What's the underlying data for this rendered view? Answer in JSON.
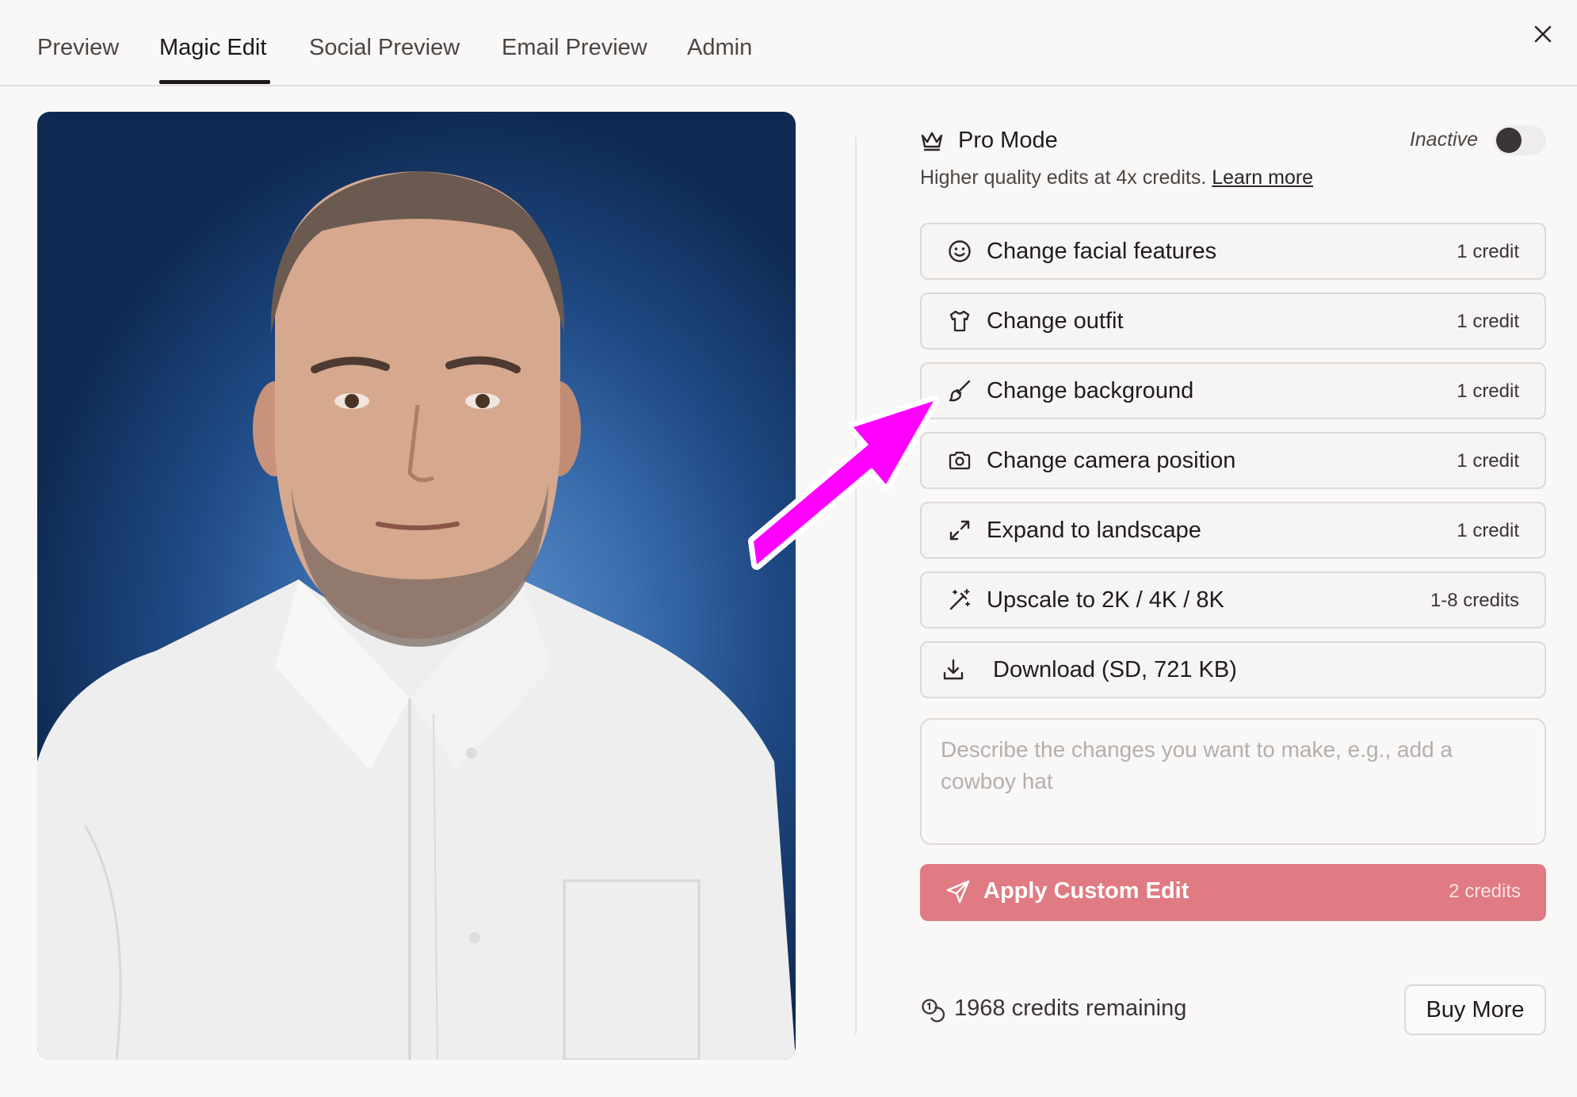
{
  "tabs": [
    {
      "label": "Preview"
    },
    {
      "label": "Magic Edit",
      "active": true
    },
    {
      "label": "Social Preview"
    },
    {
      "label": "Email Preview"
    },
    {
      "label": "Admin"
    }
  ],
  "pro_mode": {
    "title": "Pro Mode",
    "status": "Inactive",
    "enabled": false,
    "description": "Higher quality edits at 4x credits.",
    "learn_more": "Learn more"
  },
  "actions": [
    {
      "label": "Change facial features",
      "cost": "1 credit",
      "icon": "smile-icon"
    },
    {
      "label": "Change outfit",
      "cost": "1 credit",
      "icon": "shirt-icon"
    },
    {
      "label": "Change background",
      "cost": "1 credit",
      "icon": "paintbrush-icon"
    },
    {
      "label": "Change camera position",
      "cost": "1 credit",
      "icon": "camera-icon"
    },
    {
      "label": "Expand to landscape",
      "cost": "1 credit",
      "icon": "expand-icon"
    },
    {
      "label": "Upscale to 2K / 4K / 8K",
      "cost": "1-8 credits",
      "icon": "wand-sparkles-icon"
    },
    {
      "label": "Download (SD, 721 KB)",
      "icon": "download-icon"
    }
  ],
  "custom_edit": {
    "placeholder": "Describe the changes you want to make, e.g., add a cowboy hat",
    "value": "",
    "apply_label": "Apply Custom Edit",
    "apply_cost": "2 credits"
  },
  "credits": {
    "remaining_text": "1968 credits remaining",
    "buy_label": "Buy More"
  },
  "colors": {
    "apply_button": "#e07a83",
    "annotation_arrow": "#ff00ff",
    "photo_background": "#2f6aab"
  }
}
